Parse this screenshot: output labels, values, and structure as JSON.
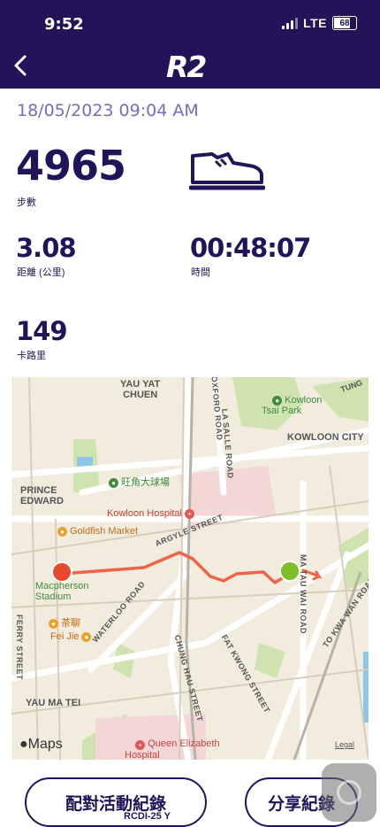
{
  "status": {
    "time": "9:52",
    "network": "LTE",
    "battery": "68"
  },
  "header": {
    "logo": "R2",
    "back_icon": "chevron-left-icon"
  },
  "record": {
    "datetime": "18/05/2023 09:04 AM",
    "steps": {
      "value": "4965",
      "label": "步數"
    },
    "distance": {
      "value": "3.08",
      "label": "距離 (公里)"
    },
    "duration": {
      "value": "00:48:07",
      "label": "時間"
    },
    "calories": {
      "value": "149",
      "label": "卡路里"
    },
    "shoe_icon": "shoe-icon"
  },
  "map": {
    "places": {
      "yau_yat_chuen": "YAU YAT\nCHUEN",
      "kowloon_tsai_park": "Kowloon\nTsai Park",
      "kowloon_city": "KOWLOON CITY",
      "prince_edward": "PRINCE\nEDWARD",
      "wong_kok_stadium": "旺角大球場",
      "kowloon_hospital": "Kowloon Hospital",
      "goldfish_market": "Goldfish Market",
      "macpherson": "Macpherson\nStadium",
      "cha_lau": "茶聊",
      "fei_jie": "Fei Jie",
      "yau_ma_tei": "YAU MA TEI",
      "queen_elizabeth": "Queen Elizabeth\nHospital",
      "tung": "TUNG"
    },
    "roads": {
      "argyle": "ARGYLE STREET",
      "waterloo": "WATERLOO ROAD",
      "chung_hau": "CHUNG HAU STREET",
      "fat_kwong": "FAT KWONG STREET",
      "ma_tau_wai": "MA TAU WAI ROAD",
      "to_kwa_wan": "TO KWA WAN ROAD",
      "la_salle": "LA SALLE ROAD",
      "oxford": "OXFORD ROAD",
      "ferry": "FERRY STREET"
    },
    "brand": "Maps",
    "legal": "Legal",
    "colors": {
      "route": "#ef6447",
      "start": "#e8492e",
      "end": "#7cbd28",
      "park": "#cfe3b0",
      "road": "#ffffff"
    }
  },
  "actions": {
    "pair_label": "配對活動紀錄",
    "share_label": "分享紀錄",
    "overlay_text": "RCDI-25 Y"
  },
  "colors": {
    "header": "#231459",
    "accent": "#7a6bbf",
    "text": "#231459"
  }
}
